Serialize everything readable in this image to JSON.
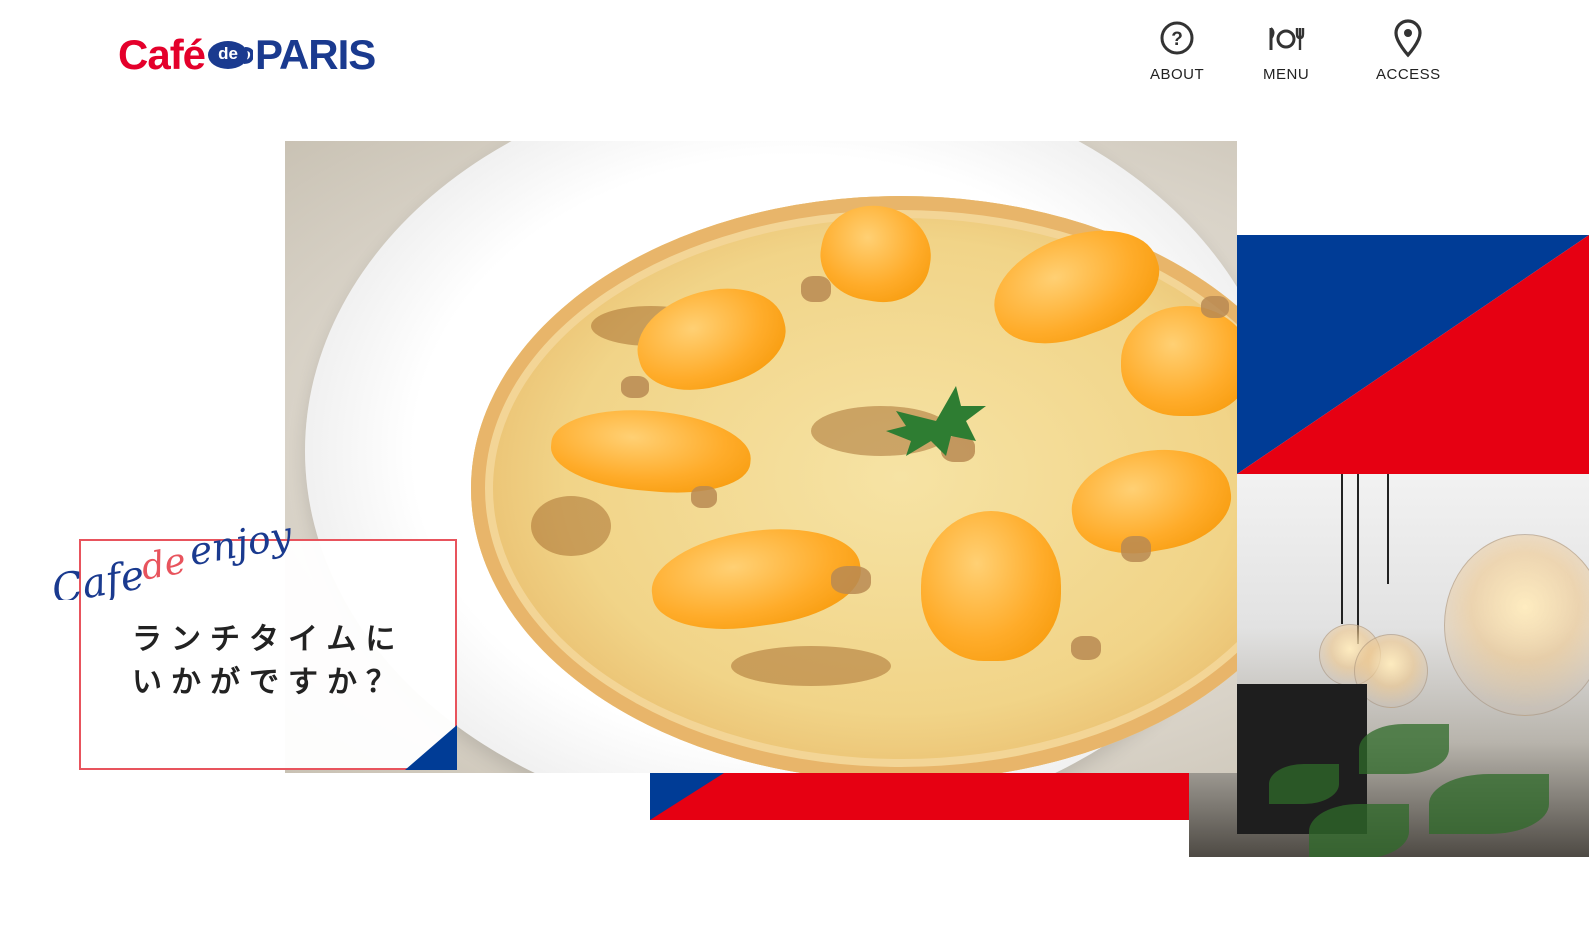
{
  "brand": {
    "logo_part1": "Café",
    "logo_part2": "de",
    "logo_part3": "PARIS",
    "red": "#e4002b",
    "blue": "#1a3a8f"
  },
  "nav": [
    {
      "label": "ABOUT",
      "icon": "question-circle-icon"
    },
    {
      "label": "MENU",
      "icon": "cutlery-plate-icon"
    },
    {
      "label": "ACCESS",
      "icon": "map-pin-icon"
    }
  ],
  "hero": {
    "script_part1": "Cafe",
    "script_part2": "de",
    "script_part3": "enjoy",
    "caption_line1": "ランチタイムに",
    "caption_line2": "いかがですか？",
    "caption_border_color": "#e8545d"
  }
}
